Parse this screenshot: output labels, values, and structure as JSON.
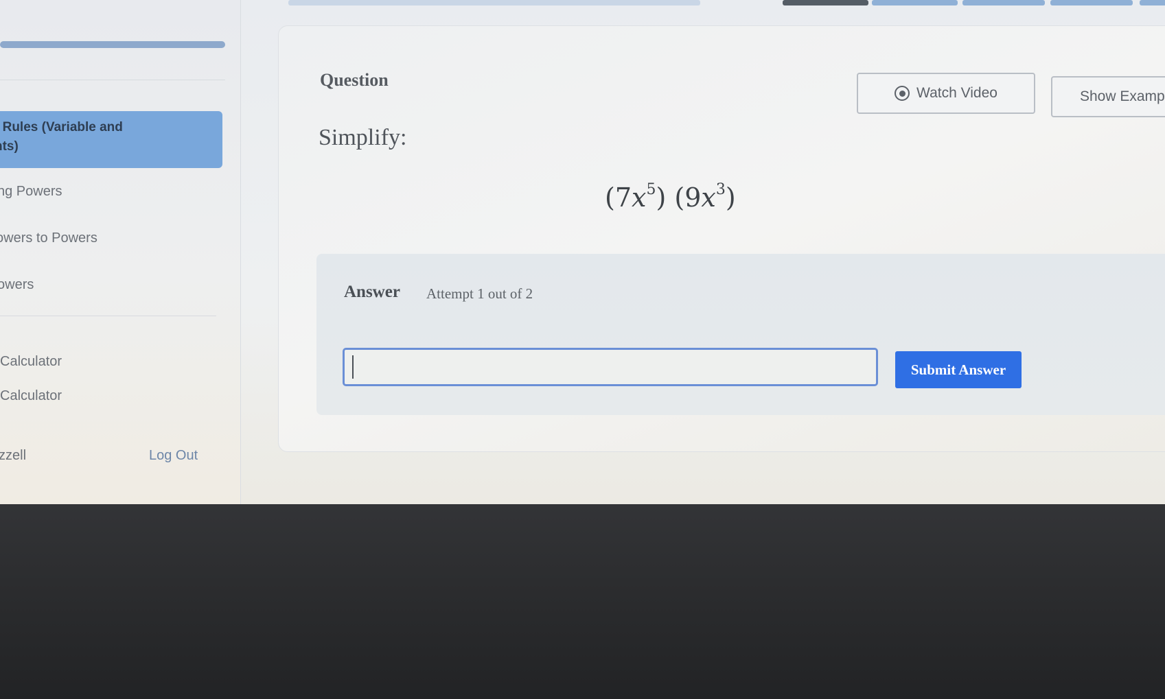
{
  "sidebar": {
    "active_item": {
      "line1": "t Rules (Variable and",
      "line2": "nts)"
    },
    "items": [
      {
        "label": "ng Powers"
      },
      {
        "label": "owers to Powers"
      },
      {
        "label": "owers"
      }
    ],
    "tools": [
      {
        "label": "Calculator"
      },
      {
        "label": "Calculator"
      }
    ],
    "user_name": "zzell",
    "logout_label": "Log Out"
  },
  "question": {
    "label": "Question",
    "watch_video_label": "Watch Video",
    "show_example_label": "Show Examp",
    "prompt": "Simplify:",
    "expression": {
      "coef1": "7",
      "var1": "x",
      "exp1": "5",
      "coef2": "9",
      "var2": "x",
      "exp2": "3"
    }
  },
  "answer": {
    "label": "Answer",
    "attempt_text": "Attempt 1 out of 2",
    "input_value": "",
    "submit_label": "Submit Answer"
  },
  "colors": {
    "accent": "#2f6fe4",
    "sidebar_active": "#79a7db",
    "input_border": "#6a8fd6"
  },
  "icons": {
    "watch_video": "play-circle-icon"
  }
}
